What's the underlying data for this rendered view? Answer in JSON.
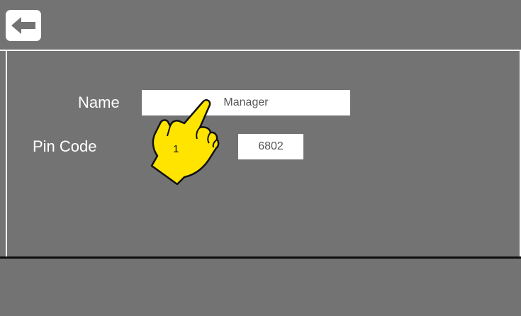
{
  "header": {
    "back_icon": "arrow-left-icon"
  },
  "form": {
    "name_label": "Name",
    "name_value": "Manager",
    "pin_label": "Pin Code",
    "pin_value": "6802"
  },
  "annotation": {
    "step_number": "1",
    "icon": "pointing-hand-icon",
    "color": "#ffe400"
  },
  "colors": {
    "background": "#737373",
    "field": "#ffffff",
    "divider": "#0d0d0d"
  }
}
